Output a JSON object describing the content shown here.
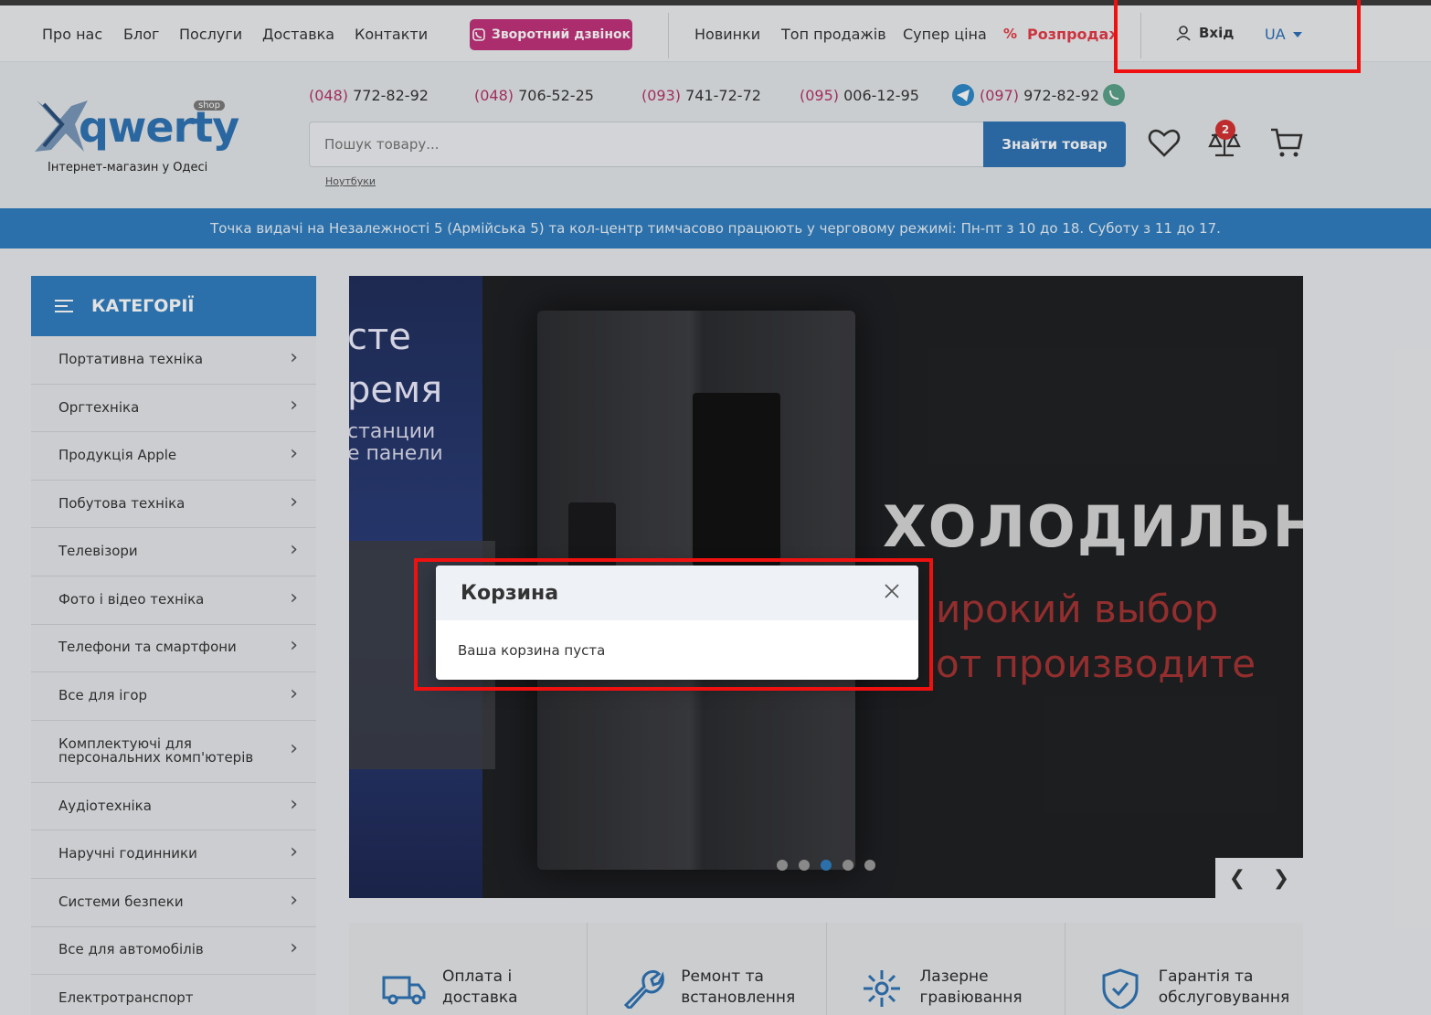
{
  "topnav": {
    "links": [
      "Про нас",
      "Блог",
      "Послуги",
      "Доставка",
      "Контакти"
    ],
    "callback": "Зворотний дзвінок",
    "links2": [
      "Новинки",
      "Топ продажів",
      "Супер ціна"
    ],
    "sale": "Розпродаж",
    "login": "Вхід",
    "lang": "UA"
  },
  "header": {
    "logo_word": "qwerty",
    "logo_shop": "shop",
    "logo_tagline": "Інтернет-магазин у Одесі",
    "phones": [
      {
        "code": "(048)",
        "num": " 772-82-92"
      },
      {
        "code": "(048)",
        "num": " 706-52-25"
      },
      {
        "code": "(093)",
        "num": " 741-72-72"
      },
      {
        "code": "(095)",
        "num": " 006-12-95"
      },
      {
        "code": "(097)",
        "num": " 972-82-92"
      }
    ],
    "search_placeholder": "Пошук товару...",
    "search_button": "Знайти товар",
    "search_hint": "Ноутбуки",
    "compare_count": "2"
  },
  "notice": "Точка видачі на Незалежності 5 (Армійська 5) та кол-центр тимчасово працюють у черговому режимі: Пн-пт з 10 до 18. Суботу з 11 до 17.",
  "sidebar": {
    "title": "КАТЕГОРІЇ",
    "items": [
      "Портативна техніка",
      "Оргтехніка",
      "Продукція Apple",
      "Побутова техніка",
      "Телевізори",
      "Фото і відео техніка",
      "Телефони та смартфони",
      "Все для ігор",
      "Комплектуючі для персональних комп'ютерів",
      "Аудіотехніка",
      "Наручні годинники",
      "Системи безпеки",
      "Все для автомобілів",
      "Електротранспорт"
    ]
  },
  "banner": {
    "left_line1": "сте",
    "left_line2": "ремя",
    "left_line3": "станции",
    "left_line4": "е панели",
    "title": "ХОЛОДИЛЬНИ",
    "sub1": "ирокий выбор",
    "sub2": "от производите",
    "slide_count": 5,
    "active_slide": 3
  },
  "services": [
    {
      "label": "Оплата і доставка",
      "icon": "truck-icon"
    },
    {
      "label": "Ремонт та встановлення",
      "icon": "wrench-icon"
    },
    {
      "label": "Лазерне гравіювання",
      "icon": "laser-icon"
    },
    {
      "label": "Гарантія та обслуговування",
      "icon": "shield-icon"
    }
  ],
  "modal": {
    "title": "Корзина",
    "body": "Ваша корзина пуста"
  },
  "colors": {
    "accent": "#2f7ec0",
    "callback": "#c2317a",
    "sale": "#e63946",
    "annotation": "#ef1010"
  }
}
